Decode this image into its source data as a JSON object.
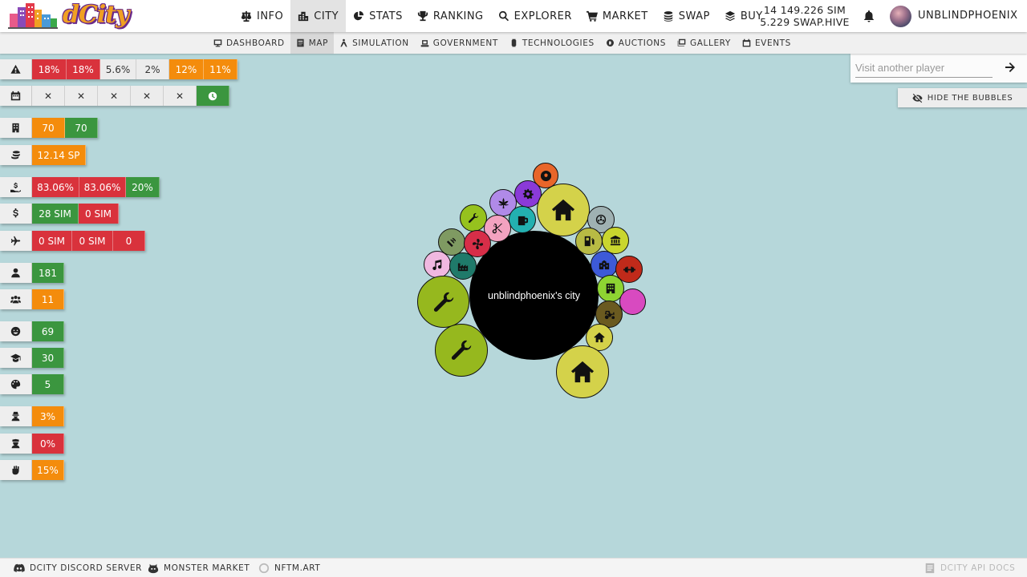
{
  "header": {
    "nav": [
      {
        "label": "INFO",
        "icon": "scale-icon"
      },
      {
        "label": "CITY",
        "icon": "city-icon"
      },
      {
        "label": "STATS",
        "icon": "pie-chart-icon"
      },
      {
        "label": "RANKING",
        "icon": "trophy-icon"
      },
      {
        "label": "EXPLORER",
        "icon": "search-icon"
      },
      {
        "label": "MARKET",
        "icon": "cart-icon"
      },
      {
        "label": "SWAP",
        "icon": "coins-icon"
      },
      {
        "label": "BUY",
        "icon": "layers-icon"
      }
    ],
    "sim_balance": "14 149.226 SIM",
    "hive_balance": "5.229 SWAP.HIVE",
    "username": "UNBLINDPHOENIX"
  },
  "subnav": [
    {
      "label": "DASHBOARD",
      "icon": "monitor-icon"
    },
    {
      "label": "MAP",
      "icon": "map-icon"
    },
    {
      "label": "SIMULATION",
      "icon": "simulation-icon"
    },
    {
      "label": "GOVERNMENT",
      "icon": "government-icon"
    },
    {
      "label": "TECHNOLOGIES",
      "icon": "chip-icon"
    },
    {
      "label": "AUCTIONS",
      "icon": "auction-icon"
    },
    {
      "label": "GALLERY",
      "icon": "gallery-icon"
    },
    {
      "label": "EVENTS",
      "icon": "calendar-icon"
    }
  ],
  "stats": {
    "warning": [
      "18%",
      "18%",
      "5.6%",
      "2%",
      "12%",
      "11%"
    ],
    "calendar": [
      "✕",
      "✕",
      "✕",
      "✕",
      "✕"
    ],
    "buildings": [
      "70",
      "70"
    ],
    "income_sp": "12.14 SP",
    "tax": [
      "83.06%",
      "83.06%",
      "20%"
    ],
    "money": [
      "28 SIM",
      "0 SIM"
    ],
    "travel": [
      "0 SIM",
      "0 SIM",
      "0"
    ],
    "population": "181",
    "workers": "11",
    "happiness": "69",
    "education": "30",
    "creativity": "5",
    "crime": "3%",
    "police": "0%",
    "protest": "15%"
  },
  "search": {
    "placeholder": "Visit another player"
  },
  "hide_bubbles_label": "HIDE THE BUBBLES",
  "city_name": "unblindphoenix's city",
  "colors": {
    "red": "#d9323c",
    "orange": "#f48c0c",
    "green": "#3b963f",
    "map_bg": "#b6d7da"
  },
  "footer": {
    "discord": "DCITY DISCORD SERVER",
    "monster": "MONSTER MARKET",
    "nftm": "NFTM.ART",
    "api": "DCITY API DOCS"
  }
}
